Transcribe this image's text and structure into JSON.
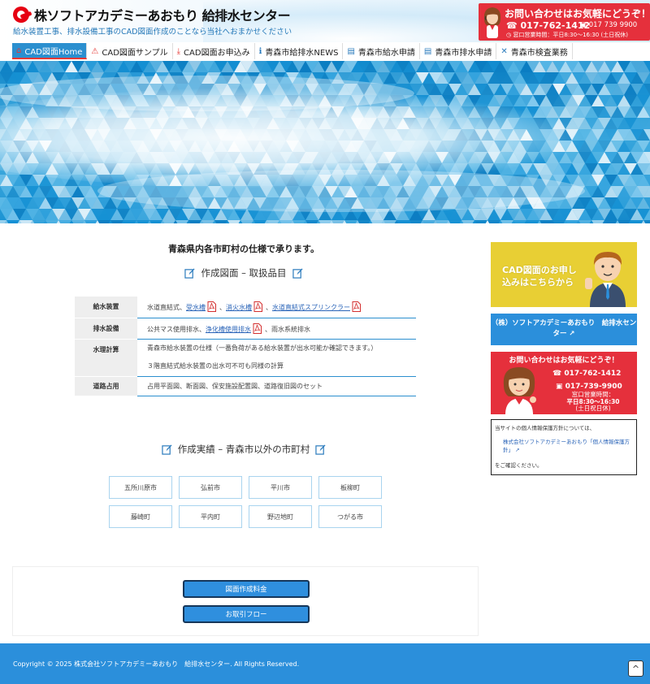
{
  "header": {
    "logo_text": "株ソフトアカデミーあおもり 給排水センター",
    "tagline": "給水装置工事、排水設備工事のCAD図面作成のことなら当社へおまかせください",
    "contact": {
      "title": "お問い合わせはお気軽にどうぞ！",
      "tel": "017-762-1412",
      "fax": "017 739 9900",
      "hours": "窓口営業時間：平日8:30〜16:30 (土日祝休)"
    }
  },
  "nav": {
    "items": [
      {
        "label": "CAD図面Home",
        "icon": "home-icon"
      },
      {
        "label": "CAD図面サンプル",
        "icon": "pdf-icon"
      },
      {
        "label": "CAD図面お申込み",
        "icon": "download-icon"
      },
      {
        "label": "青森市給排水NEWS",
        "icon": "info-icon"
      },
      {
        "label": "青森市給水申請",
        "icon": "file-icon"
      },
      {
        "label": "青森市排水申請",
        "icon": "file-icon"
      },
      {
        "label": "青森市検査業務",
        "icon": "tools-icon"
      }
    ]
  },
  "main": {
    "title": "青森県内各市町村の仕様で承ります。",
    "section1_heading": "作成図面 – 取扱品目",
    "table": {
      "rows": [
        {
          "header": "給水装置",
          "prefix": "水道直結式、",
          "link1": "受水槽",
          "sep1": "、",
          "link2": "消火水槽",
          "sep2": "、",
          "link3": "水道直結式スプリンクラー"
        },
        {
          "header": "排水設備",
          "prefix": "公共マス使用排水、",
          "link1": "浄化槽使用排水",
          "suffix": "、雨水系統排水"
        },
        {
          "header": "水理計算",
          "line1": "青森市給水装置の仕様（一番負荷がある給水装置が出水可能か確認できます。）",
          "line2": "３階直結式給水装置の出水可不可も同様の計算"
        },
        {
          "header": "道路占用",
          "text": "占用平面図、断面図、保安施設配置図、道路復旧図のセット"
        }
      ]
    },
    "section2_heading": "作成実績 – 青森市以外の市町村",
    "cities": [
      "五所川原市",
      "弘前市",
      "平川市",
      "板柳町",
      "藤崎町",
      "平内町",
      "野辺地町",
      "つがる市"
    ],
    "buttons": {
      "price": "図面作成料金",
      "flow": "お取引フロー"
    }
  },
  "sidebar": {
    "banner_text_line1": "CAD図面のお申し",
    "banner_text_line2": "込みはこちらから",
    "company_button": "（株）ソフトアカデミーあおもり　給排水センター",
    "contact": {
      "title": "お問い合わせはお気軽にどうぞ！",
      "tel": "017-762-1412",
      "fax": "017-739-9900",
      "hours_label": "窓口営業時間：",
      "hours_value": "平日8:30〜16:30",
      "holiday": "(土日祝日休)"
    },
    "privacy": {
      "intro": "当サイトの個人情報保護方針については、",
      "link": "株式会社ソフトアカデミーあおもり「個人情報保護方針」",
      "outro": "をご確認ください。"
    }
  },
  "footer": {
    "copyright": "Copyright © 2025 株式会社ソフトアカデミーあおもり　給排水センター. All Rights Reserved.",
    "to_top": "^"
  },
  "colors": {
    "brand_blue": "#2b8fdb",
    "brand_red": "#e5303c",
    "banner_yellow": "#e8cf34"
  }
}
